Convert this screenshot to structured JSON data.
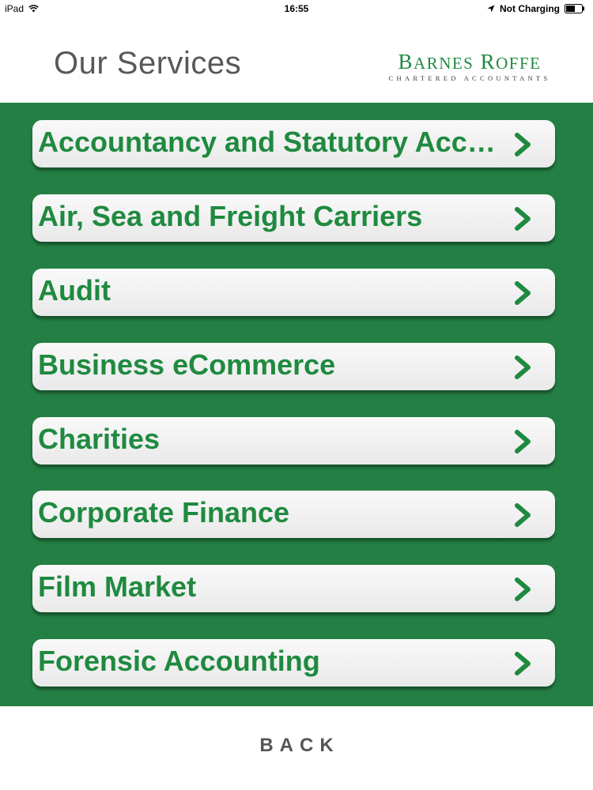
{
  "status_bar": {
    "device": "iPad",
    "time": "16:55",
    "charging": "Not Charging"
  },
  "header": {
    "title": "Our Services",
    "logo": {
      "name_first_initial": "B",
      "name_first_rest": "ARNES",
      "name_second_initial": "R",
      "name_second_rest": "OFFE",
      "tagline": "CHARTERED ACCOUNTANTS"
    }
  },
  "services": [
    {
      "label": "Accountancy and Statutory Accounts"
    },
    {
      "label": "Air, Sea and Freight Carriers"
    },
    {
      "label": "Audit"
    },
    {
      "label": "Business eCommerce"
    },
    {
      "label": "Charities"
    },
    {
      "label": "Corporate Finance"
    },
    {
      "label": "Film Market"
    },
    {
      "label": "Forensic Accounting"
    }
  ],
  "back": {
    "label": "BACK"
  },
  "colors": {
    "brand_green": "#237f43",
    "label_green": "#1f8a3f",
    "title_gray": "#585858"
  },
  "icons": {
    "status": [
      "wifi-icon",
      "location-icon",
      "battery-icon"
    ],
    "row": "chevron-right-icon"
  }
}
